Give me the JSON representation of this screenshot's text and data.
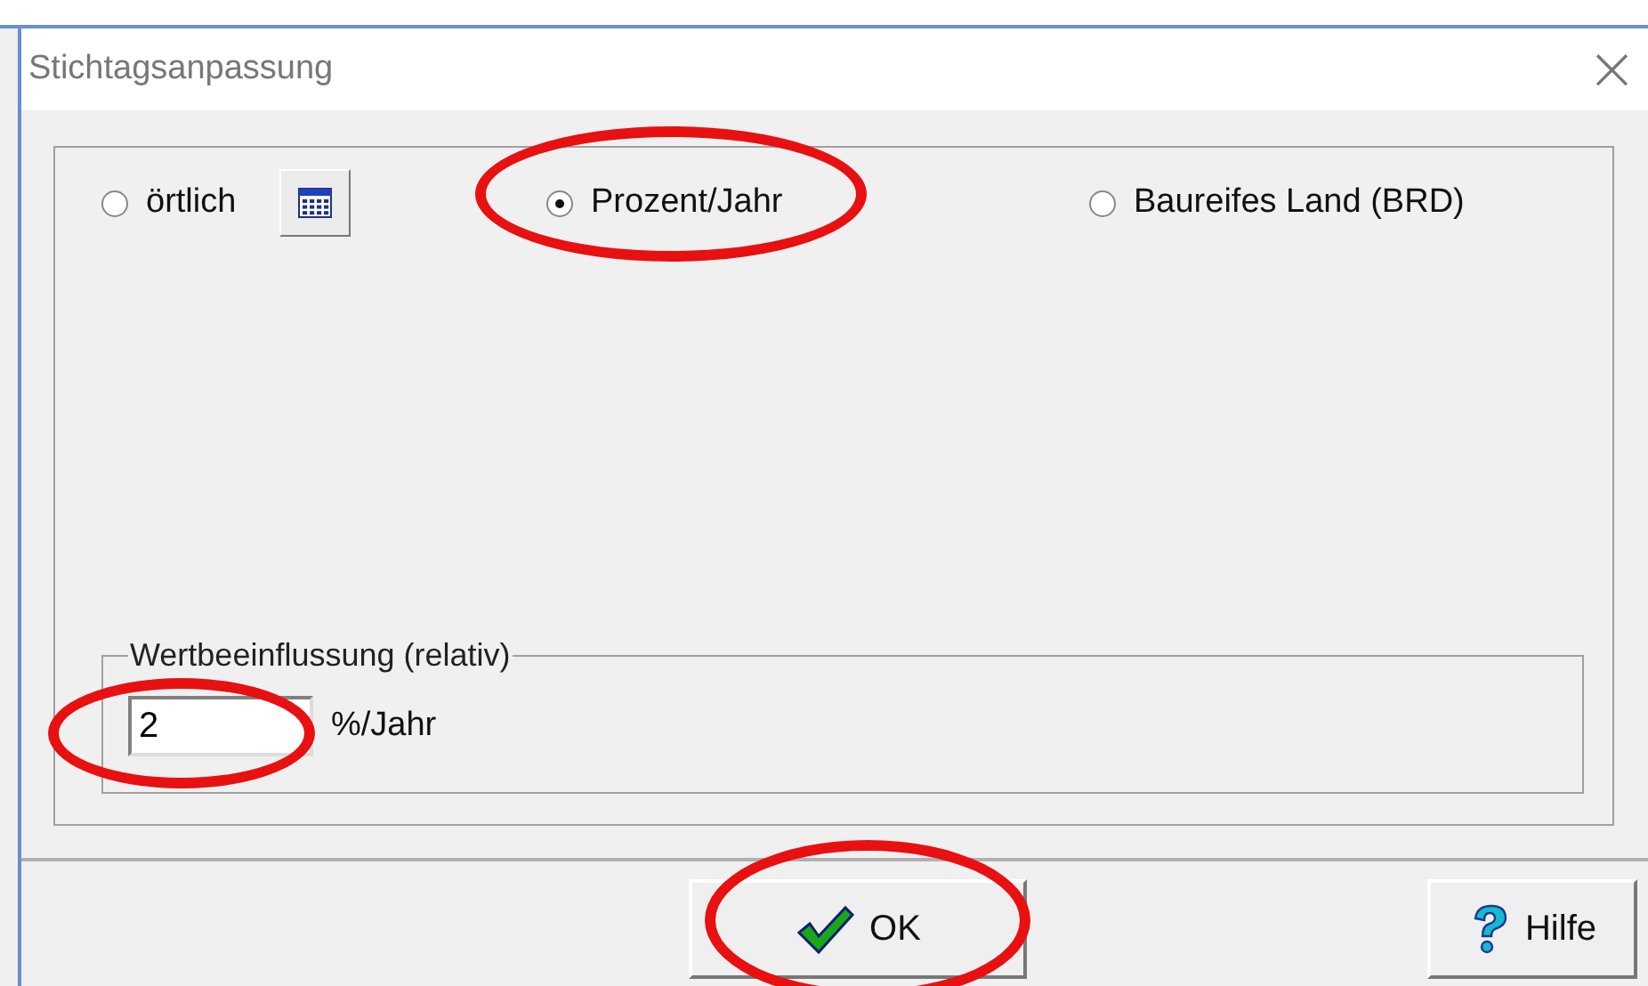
{
  "window": {
    "title": "Stichtagsanpassung",
    "close_glyph": "×"
  },
  "options": [
    {
      "label": "örtlich",
      "selected": false,
      "circled": false,
      "has_table_button": true
    },
    {
      "label": "Prozent/Jahr",
      "selected": true,
      "circled": true,
      "has_table_button": false
    },
    {
      "label": "Baureifes Land (BRD)",
      "selected": false,
      "circled": false,
      "has_table_button": false
    }
  ],
  "group": {
    "title": "Wertbeeinflussung (relativ)",
    "value": "2",
    "unit": "%/Jahr",
    "circled": true
  },
  "buttons": [
    {
      "kind": "ok",
      "label": "OK",
      "circled": true
    },
    {
      "kind": "help",
      "label": "Hilfe",
      "circled": false
    }
  ]
}
